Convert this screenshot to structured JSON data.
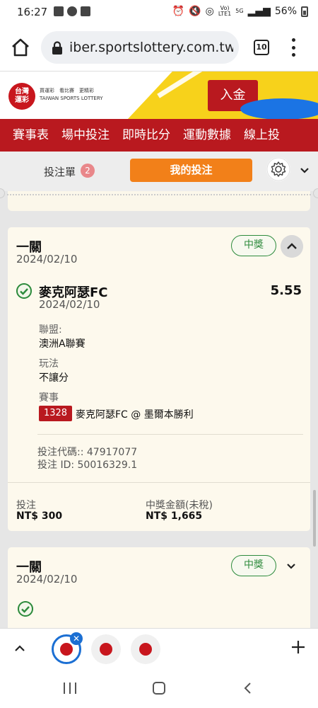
{
  "status_bar": {
    "time": "16:27",
    "network": "5G",
    "battery": "56%"
  },
  "browser": {
    "url": "iber.sportslottery.com.tw",
    "tab_count": "10"
  },
  "site_header": {
    "logo_text": "台灣\n運彩",
    "tagline_1": "買運彩　看比賽　更精彩",
    "tagline_2": "TAIWAN SPORTS LOTTERY",
    "deposit_label": "入金"
  },
  "nav": {
    "items": [
      "賽事表",
      "場中投注",
      "即時比分",
      "運動數據",
      "線上投"
    ]
  },
  "subbar": {
    "betslip_label": "投注單",
    "betslip_count": "2",
    "my_bets_label": "我的投注"
  },
  "tickets": [
    {
      "type": "一關",
      "date": "2024/02/10",
      "status": "中獎",
      "team": "麥克阿瑟FC",
      "odds": "5.55",
      "team_date": "2024/02/10",
      "league_label": "聯盟:",
      "league": "澳洲A聯賽",
      "play_label": "玩法",
      "play": "不讓分",
      "event_label": "賽事",
      "event_id": "1328",
      "event_name": "麥克阿瑟FC @ 墨爾本勝利",
      "bet_code": "投注代碼:: 47917077",
      "bet_id": "投注 ID: 50016329.1",
      "stake_label": "投注",
      "stake": "NT$ 300",
      "payout_label": "中獎金額(未稅)",
      "payout": "NT$ 1,665"
    },
    {
      "type": "一關",
      "date": "2024/02/10",
      "status": "中獎"
    }
  ],
  "colors": {
    "brand_red": "#b9191f",
    "orange": "#f28019",
    "win_green": "#2e8b3d",
    "card_bg": "#fdf9ed"
  },
  "icons": {
    "home": "home-icon",
    "lock": "lock-icon",
    "settings": "gear-icon",
    "check": "check-circle-icon"
  }
}
